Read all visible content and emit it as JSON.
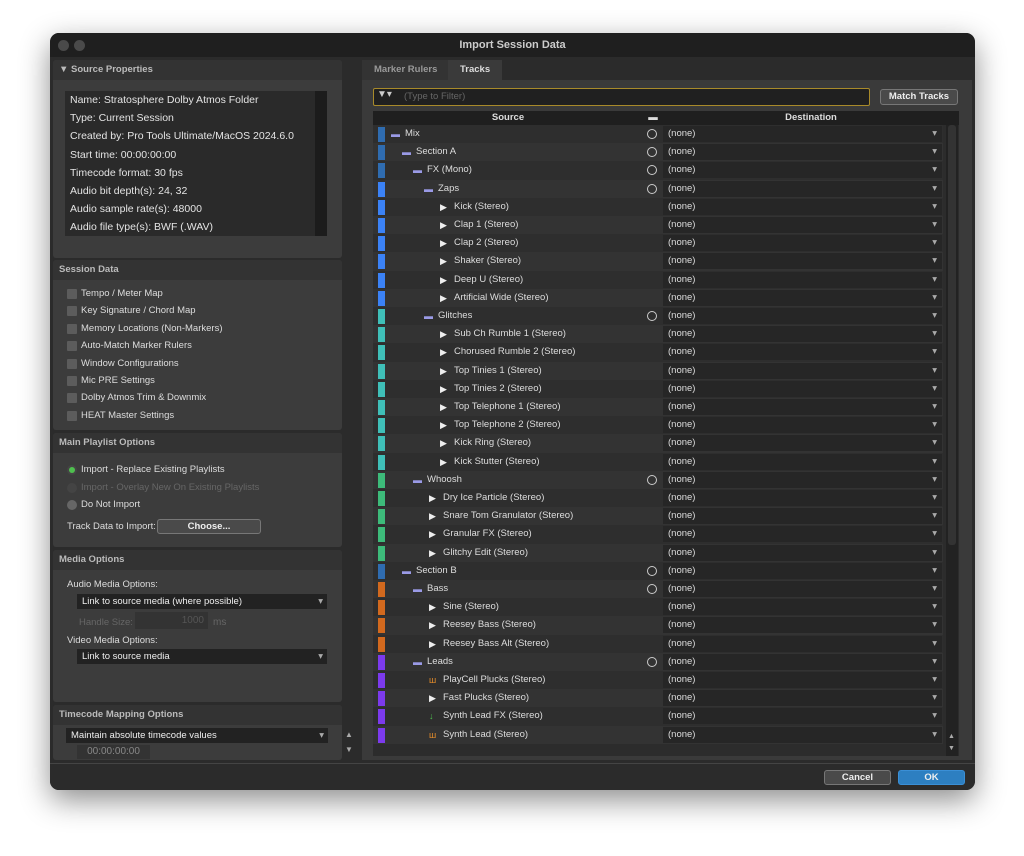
{
  "window": {
    "title": "Import Session Data"
  },
  "source_properties": {
    "header": "▼ Source Properties",
    "lines": [
      "Name: Stratosphere Dolby Atmos Folder",
      "Type: Current Session",
      "Created by: Pro Tools Ultimate/MacOS 2024.6.0",
      "Start time: 00:00:00:00",
      "Timecode format: 30 fps",
      "Audio bit depth(s): 24, 32",
      "Audio sample rate(s): 48000",
      "Audio file type(s): BWF (.WAV)"
    ]
  },
  "session_data": {
    "header": "Session Data",
    "items": [
      {
        "label": "Tempo / Meter Map",
        "checked": false
      },
      {
        "label": "Key Signature / Chord Map",
        "checked": false
      },
      {
        "label": "Memory Locations (Non-Markers)",
        "checked": false
      },
      {
        "label": "Auto-Match Marker Rulers",
        "checked": false
      },
      {
        "label": "Window Configurations",
        "checked": false
      },
      {
        "label": "Mic PRE Settings",
        "checked": false
      },
      {
        "label": "Dolby Atmos Trim & Downmix",
        "checked": false
      },
      {
        "label": "HEAT Master Settings",
        "checked": false
      }
    ]
  },
  "playlist": {
    "header": "Main Playlist Options",
    "options": [
      {
        "label": "Import - Replace Existing Playlists",
        "selected": true,
        "enabled": true
      },
      {
        "label": "Import - Overlay New On Existing Playlists",
        "selected": false,
        "enabled": false
      },
      {
        "label": "Do Not Import",
        "selected": false,
        "enabled": true
      }
    ],
    "track_data_label": "Track Data to Import:",
    "choose_label": "Choose..."
  },
  "media": {
    "header": "Media Options",
    "audio_label": "Audio Media Options:",
    "audio_value": "Link to source media (where possible)",
    "handle_label": "Handle Size:",
    "handle_value": "1000",
    "handle_unit": "ms",
    "video_label": "Video Media Options:",
    "video_value": "Link to source media"
  },
  "timecode": {
    "header": "Timecode Mapping Options",
    "value": "Maintain absolute timecode values",
    "time_value": "00:00:00:00"
  },
  "tabs": [
    {
      "label": "Marker Rulers",
      "active": false
    },
    {
      "label": "Tracks",
      "active": true
    }
  ],
  "filter": {
    "placeholder": "(Type to Filter)"
  },
  "match_tracks_label": "Match Tracks",
  "columns": {
    "source": "Source",
    "destination": "Destination"
  },
  "tracks": [
    {
      "name": "Mix",
      "depth": 0,
      "type": "folder",
      "color": "#2f6cb0",
      "circle": true,
      "dest": "(none)"
    },
    {
      "name": "Section A",
      "depth": 1,
      "type": "folder",
      "color": "#2f6cb0",
      "circle": true,
      "dest": "(none)"
    },
    {
      "name": "FX (Mono)",
      "depth": 2,
      "type": "folder",
      "color": "#2f6cb0",
      "circle": true,
      "dest": "(none)"
    },
    {
      "name": "Zaps",
      "depth": 3,
      "type": "folder",
      "color": "#3b82f6",
      "circle": true,
      "dest": "(none)"
    },
    {
      "name": "Kick (Stereo)",
      "depth": 4,
      "type": "audio",
      "color": "#3b82f6",
      "circle": false,
      "dest": "(none)"
    },
    {
      "name": "Clap 1 (Stereo)",
      "depth": 4,
      "type": "audio",
      "color": "#3b82f6",
      "circle": false,
      "dest": "(none)"
    },
    {
      "name": "Clap 2 (Stereo)",
      "depth": 4,
      "type": "audio",
      "color": "#3b82f6",
      "circle": false,
      "dest": "(none)"
    },
    {
      "name": "Shaker (Stereo)",
      "depth": 4,
      "type": "audio",
      "color": "#3b82f6",
      "circle": false,
      "dest": "(none)"
    },
    {
      "name": "Deep U (Stereo)",
      "depth": 4,
      "type": "audio",
      "color": "#3b82f6",
      "circle": false,
      "dest": "(none)"
    },
    {
      "name": "Artificial Wide (Stereo)",
      "depth": 4,
      "type": "audio",
      "color": "#3b82f6",
      "circle": false,
      "dest": "(none)"
    },
    {
      "name": "Glitches",
      "depth": 3,
      "type": "folder",
      "color": "#3fbfb8",
      "circle": true,
      "dest": "(none)"
    },
    {
      "name": "Sub Ch Rumble 1 (Stereo)",
      "depth": 4,
      "type": "audio",
      "color": "#3fbfb8",
      "circle": false,
      "dest": "(none)"
    },
    {
      "name": "Chorused Rumble 2 (Stereo)",
      "depth": 4,
      "type": "audio",
      "color": "#3fbfb8",
      "circle": false,
      "dest": "(none)"
    },
    {
      "name": "Top Tinies 1 (Stereo)",
      "depth": 4,
      "type": "audio",
      "color": "#3fbfb8",
      "circle": false,
      "dest": "(none)"
    },
    {
      "name": "Top Tinies 2 (Stereo)",
      "depth": 4,
      "type": "audio",
      "color": "#3fbfb8",
      "circle": false,
      "dest": "(none)"
    },
    {
      "name": "Top Telephone 1 (Stereo)",
      "depth": 4,
      "type": "audio",
      "color": "#3fbfb8",
      "circle": false,
      "dest": "(none)"
    },
    {
      "name": "Top Telephone 2 (Stereo)",
      "depth": 4,
      "type": "audio",
      "color": "#3fbfb8",
      "circle": false,
      "dest": "(none)"
    },
    {
      "name": "Kick Ring (Stereo)",
      "depth": 4,
      "type": "audio",
      "color": "#3fbfb8",
      "circle": false,
      "dest": "(none)"
    },
    {
      "name": "Kick Stutter (Stereo)",
      "depth": 4,
      "type": "audio",
      "color": "#3fbfb8",
      "circle": false,
      "dest": "(none)"
    },
    {
      "name": "Whoosh",
      "depth": 2,
      "type": "folder",
      "color": "#3dbb7a",
      "circle": true,
      "dest": "(none)"
    },
    {
      "name": "Dry Ice Particle (Stereo)",
      "depth": 3,
      "type": "audio",
      "color": "#3dbb7a",
      "circle": false,
      "dest": "(none)"
    },
    {
      "name": "Snare Tom Granulator (Stereo)",
      "depth": 3,
      "type": "audio",
      "color": "#3dbb7a",
      "circle": false,
      "dest": "(none)"
    },
    {
      "name": "Granular FX (Stereo)",
      "depth": 3,
      "type": "audio",
      "color": "#3dbb7a",
      "circle": false,
      "dest": "(none)"
    },
    {
      "name": "Glitchy Edit (Stereo)",
      "depth": 3,
      "type": "audio",
      "color": "#3dbb7a",
      "circle": false,
      "dest": "(none)"
    },
    {
      "name": "Section B",
      "depth": 1,
      "type": "folder",
      "color": "#2f6cb0",
      "circle": true,
      "dest": "(none)"
    },
    {
      "name": "Bass",
      "depth": 2,
      "type": "folder",
      "color": "#d2691e",
      "circle": true,
      "dest": "(none)"
    },
    {
      "name": "Sine (Stereo)",
      "depth": 3,
      "type": "audio",
      "color": "#d2691e",
      "circle": false,
      "dest": "(none)"
    },
    {
      "name": "Reesey Bass (Stereo)",
      "depth": 3,
      "type": "audio",
      "color": "#d2691e",
      "circle": false,
      "dest": "(none)"
    },
    {
      "name": "Reesey Bass Alt (Stereo)",
      "depth": 3,
      "type": "audio",
      "color": "#d2691e",
      "circle": false,
      "dest": "(none)"
    },
    {
      "name": "Leads",
      "depth": 2,
      "type": "folder",
      "color": "#7c3aed",
      "circle": true,
      "dest": "(none)"
    },
    {
      "name": "PlayCell Plucks (Stereo)",
      "depth": 3,
      "type": "instrument",
      "color": "#7c3aed",
      "circle": false,
      "dest": "(none)"
    },
    {
      "name": "Fast Plucks (Stereo)",
      "depth": 3,
      "type": "audio",
      "color": "#7c3aed",
      "circle": false,
      "dest": "(none)"
    },
    {
      "name": "Synth Lead FX (Stereo)",
      "depth": 3,
      "type": "aux",
      "color": "#7c3aed",
      "circle": false,
      "dest": "(none)"
    },
    {
      "name": "Synth Lead (Stereo)",
      "depth": 3,
      "type": "instrument",
      "color": "#7c3aed",
      "circle": false,
      "dest": "(none)"
    }
  ],
  "footer": {
    "cancel_label": "Cancel",
    "ok_label": "OK"
  },
  "colors": {
    "accent": "#2d7fc1",
    "filter_border": "#a88a2a",
    "radio_selected": "#4ec04e"
  }
}
